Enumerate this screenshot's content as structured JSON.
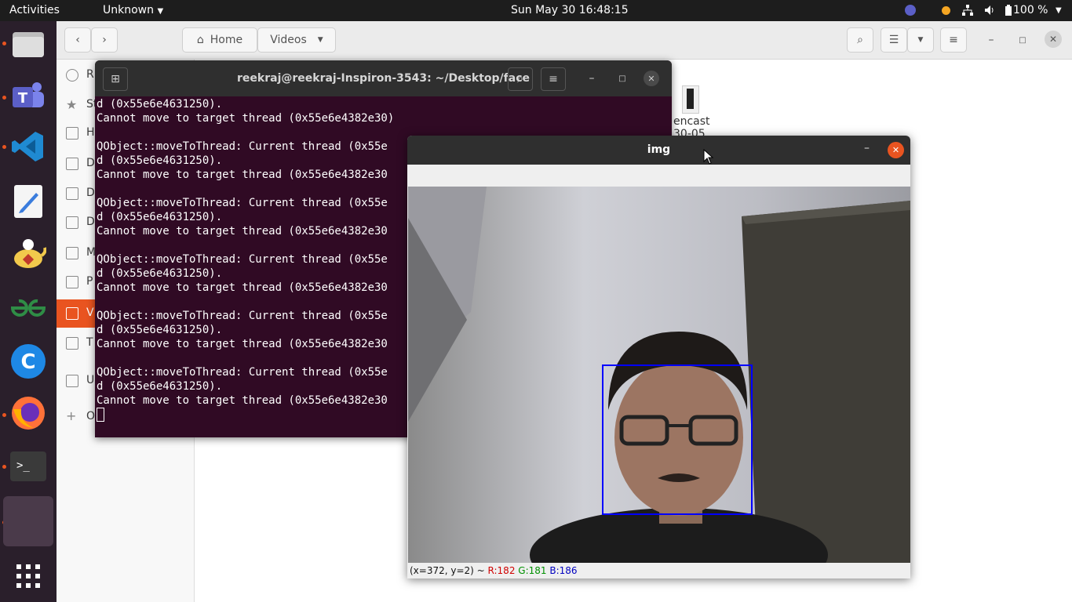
{
  "topbar": {
    "activities": "Activities",
    "app_menu": "Unknown",
    "clock": "Sun May 30  16:48:15",
    "battery": "100 %"
  },
  "dock": {
    "apps": [
      {
        "name": "files",
        "color": "#d9d9d9"
      },
      {
        "name": "teams",
        "color": "#5b5fc7"
      },
      {
        "name": "vscode",
        "color": "#1f8ad2"
      },
      {
        "name": "text-editor",
        "color": "#f5f5f5"
      },
      {
        "name": "aisleriot",
        "color": "#f2c94c"
      },
      {
        "name": "geeksforgeeks",
        "color": "#2f8d46"
      },
      {
        "name": "c-app",
        "color": "#1e88e5"
      },
      {
        "name": "firefox",
        "color": "#ff7139"
      },
      {
        "name": "terminal",
        "color": "#3a3a3a"
      }
    ]
  },
  "files": {
    "header": {
      "location_home": "Home",
      "location_videos": "Videos"
    },
    "sidebar": [
      "R",
      "St",
      "H",
      "D",
      "D",
      "D",
      "M",
      "P",
      "V",
      "T",
      "U",
      "O"
    ],
    "file_name_line1": "encast",
    "file_name_line2": "30-05"
  },
  "terminal": {
    "title": "reekraj@reekraj-Inspiron-3543: ~/Desktop/face",
    "lines": [
      "d (0x55e6e4631250).",
      "Cannot move to target thread (0x55e6e4382e30)",
      "",
      "QObject::moveToThread: Current thread (0x55e",
      "d (0x55e6e4631250).",
      "Cannot move to target thread (0x55e6e4382e30",
      "",
      "QObject::moveToThread: Current thread (0x55e",
      "d (0x55e6e4631250).",
      "Cannot move to target thread (0x55e6e4382e30",
      "",
      "QObject::moveToThread: Current thread (0x55e",
      "d (0x55e6e4631250).",
      "Cannot move to target thread (0x55e6e4382e30",
      "",
      "QObject::moveToThread: Current thread (0x55e",
      "d (0x55e6e4631250).",
      "Cannot move to target thread (0x55e6e4382e30",
      "",
      "QObject::moveToThread: Current thread (0x55e",
      "d (0x55e6e4631250).",
      "Cannot move to target thread (0x55e6e4382e30"
    ]
  },
  "img_window": {
    "title": "img",
    "status_coords": "(x=372, y=2) ~ ",
    "status_r": "R:182",
    "status_g": "G:181",
    "status_b": "B:186"
  },
  "colors": {
    "accent": "#e95420",
    "terminal_bg": "#300a24",
    "face_box": "#0000ff",
    "r": "#d00000",
    "g": "#009000",
    "b": "#0000c0"
  }
}
